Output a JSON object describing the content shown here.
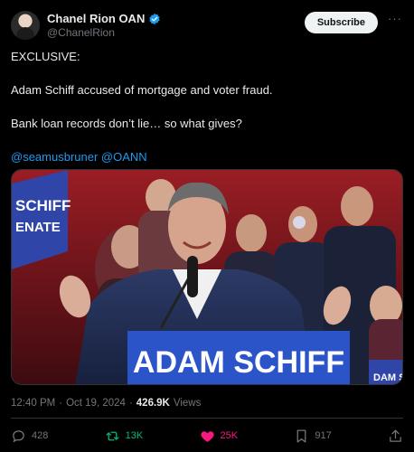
{
  "author": {
    "name": "Chanel Rion OAN",
    "handle": "@ChanelRion",
    "subscribe_label": "Subscribe",
    "more_label": "···"
  },
  "tweet": {
    "line1": "EXCLUSIVE:",
    "line2": "Adam Schiff accused of mortgage and voter fraud.",
    "line3": "Bank loan records don’t lie… so what gives?",
    "mention1": "@seamusbruner",
    "mention2": "@OANN"
  },
  "media": {
    "podium_sign": "ADAM SCHIFF",
    "left_sign_line1": "SCHIFF",
    "left_sign_line2": "ENATE",
    "right_sign": "DAM S"
  },
  "meta": {
    "time": "12:40 PM",
    "separator": "·",
    "date": "Oct 19, 2024",
    "views_count": "426.9K",
    "views_label": "Views"
  },
  "actions": {
    "replies": "428",
    "retweets": "13K",
    "likes": "25K",
    "bookmarks": "917"
  },
  "colors": {
    "background": "#000000",
    "accent": "#1d9bf0",
    "retweet": "#00ba7c",
    "like": "#f91880"
  }
}
